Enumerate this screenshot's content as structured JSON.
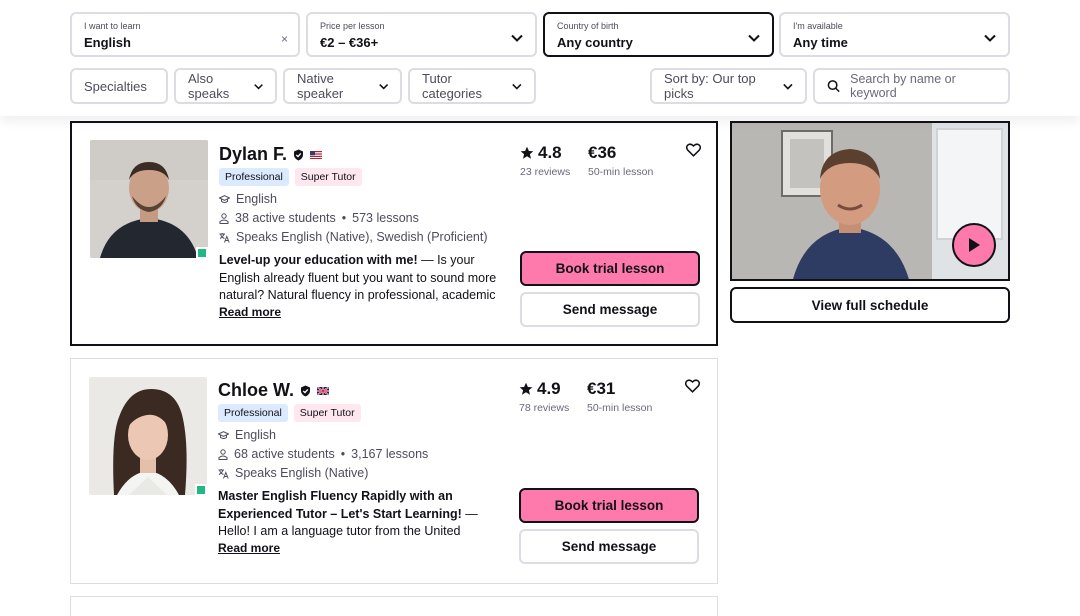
{
  "filters": {
    "learn": {
      "label": "I want to learn",
      "value": "English",
      "clear": "×"
    },
    "price": {
      "label": "Price per lesson",
      "value": "€2 – €36+"
    },
    "country": {
      "label": "Country of birth",
      "value": "Any country"
    },
    "available": {
      "label": "I'm available",
      "value": "Any time"
    }
  },
  "pills": {
    "specialties": "Specialties",
    "also_speaks": "Also speaks",
    "native_speaker": "Native speaker",
    "tutor_categories": "Tutor categories",
    "sort": "Sort by: Our top picks"
  },
  "search": {
    "placeholder": "Search by name or keyword"
  },
  "tutors": [
    {
      "name": "Dylan F.",
      "badge_professional": "Professional",
      "badge_super": "Super Tutor",
      "subject": "English",
      "active_students": "38 active students",
      "lessons": "573 lessons",
      "speaks": "Speaks English (Native), Swedish (Proficient)",
      "desc_bold": "Level-up your education with me!",
      "desc_rest": " — Is your English already fluent but you want to sound more natural? Natural fluency in professional, academic and social",
      "read_more": "Read more",
      "rating": "4.8",
      "reviews": "23 reviews",
      "price": "€36",
      "price_sub": "50-min lesson",
      "trial": "Book trial lesson",
      "message": "Send message",
      "flag": "us"
    },
    {
      "name": "Chloe W.",
      "badge_professional": "Professional",
      "badge_super": "Super Tutor",
      "subject": "English",
      "active_students": "68 active students",
      "lessons": "3,167 lessons",
      "speaks": "Speaks English (Native)",
      "desc_bold": "Master English Fluency Rapidly with an Experienced Tutor – Let's Start Learning!",
      "desc_rest": " — Hello! I am a language tutor from the United Kingdom. If you're aiming to",
      "read_more": "Read more",
      "rating": "4.9",
      "reviews": "78 reviews",
      "price": "€31",
      "price_sub": "50-min lesson",
      "trial": "Book trial lesson",
      "message": "Send message",
      "flag": "uk"
    }
  ],
  "side": {
    "schedule": "View full schedule"
  },
  "icons": {
    "chevron": "chevron-down-icon",
    "search": "search-icon",
    "star": "star-icon",
    "heart": "heart-icon",
    "play": "play-icon",
    "verified": "verified-icon",
    "subject": "graduation-cap-icon",
    "students": "user-icon",
    "languages": "translate-icon"
  },
  "colors": {
    "accent": "#ff7aac",
    "border": "#dcdce5",
    "online": "#1fb886",
    "pro_badge": "#dbeafe",
    "super_badge": "#ffe7ef"
  }
}
